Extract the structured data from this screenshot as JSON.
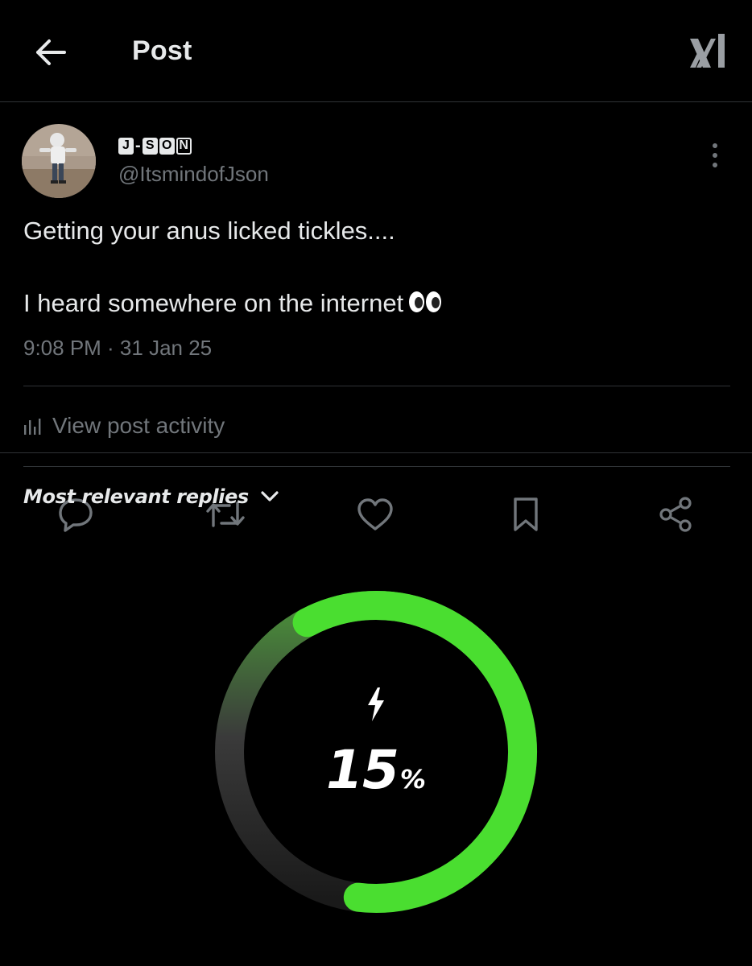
{
  "header": {
    "title": "Post",
    "back_icon": "arrow-left-icon",
    "logo_icon": "xai-logo-icon"
  },
  "post": {
    "author": {
      "display_name_letters": [
        "J",
        "-",
        "S",
        "O",
        "N"
      ],
      "handle": "@ItsmindofJson"
    },
    "text_line_1": "Getting your anus licked tickles....",
    "text_line_2": "I heard somewhere on the internet",
    "text_emoji": "eyes-emoji",
    "timestamp": "9:08 PM · 31 Jan 25",
    "activity_label": "View post activity",
    "actions": [
      {
        "name": "reply",
        "icon": "reply-icon"
      },
      {
        "name": "repost",
        "icon": "repost-icon"
      },
      {
        "name": "like",
        "icon": "heart-icon"
      },
      {
        "name": "bookmark",
        "icon": "bookmark-icon"
      },
      {
        "name": "share",
        "icon": "share-icon"
      }
    ]
  },
  "replies": {
    "sort_label": "Most relevant replies",
    "sort_icon": "chevron-down-icon"
  },
  "battery_overlay": {
    "percent_number": "15",
    "percent_unit": "%",
    "level": 0.15,
    "icon": "lightning-bolt-icon",
    "accent_color": "#4ade30",
    "track_color": "#2a2a2a"
  },
  "colors": {
    "background": "#000000",
    "text_primary": "#e7e9ea",
    "text_secondary": "#71767b",
    "divider": "#2f3336"
  }
}
